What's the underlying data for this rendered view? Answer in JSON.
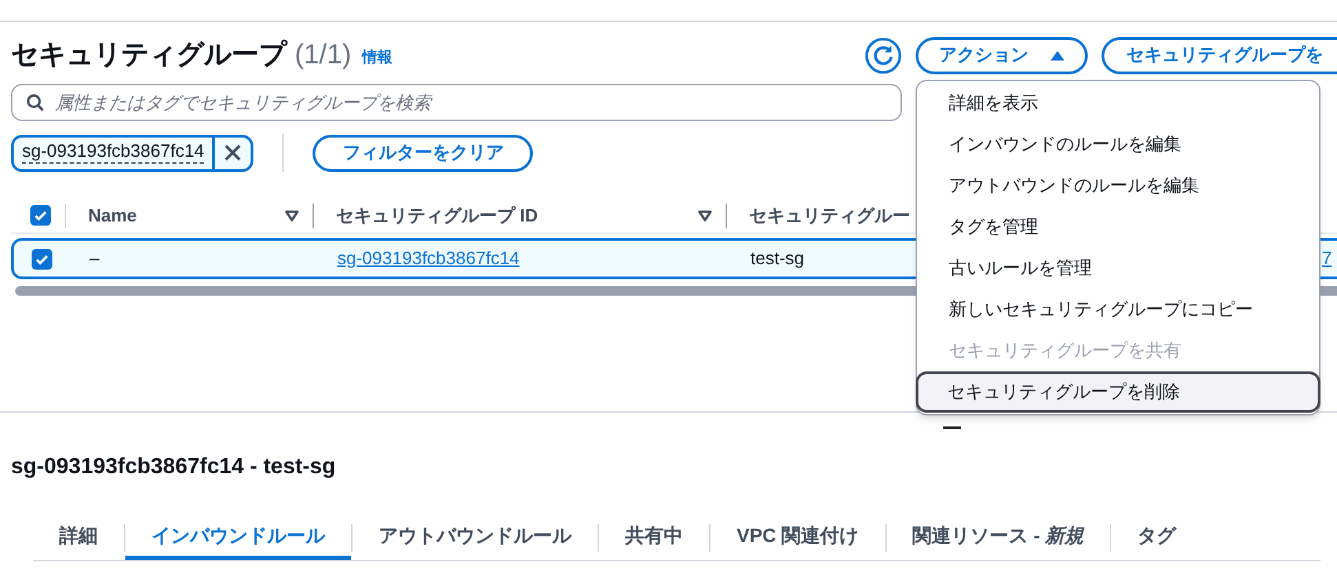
{
  "header": {
    "title": "セキュリティグループ",
    "count": "(1/1)",
    "info_link": "情報"
  },
  "toolbar": {
    "actions_button": "アクション",
    "actions_expanded": true,
    "create_button": "セキュリティグループを"
  },
  "search": {
    "placeholder": "属性またはタグでセキュリティグループを検索"
  },
  "filter": {
    "token": "sg-093193fcb3867fc14",
    "clear_button": "フィルターをクリア"
  },
  "table": {
    "select_all_checked": true,
    "columns": [
      {
        "label": "Name",
        "sortable": true
      },
      {
        "label": "セキュリティグループ ID",
        "sortable": true
      },
      {
        "label": "セキュリティグルー"
      }
    ],
    "rows": [
      {
        "selected": true,
        "name": "–",
        "group_id": "sg-093193fcb3867fc14",
        "column_3": "test-sg",
        "column_4": "7"
      }
    ]
  },
  "actions_menu": {
    "items": [
      {
        "label": "詳細を表示",
        "disabled": false,
        "focused": false
      },
      {
        "label": "インバウンドのルールを編集",
        "disabled": false,
        "focused": false
      },
      {
        "label": "アウトバウンドのルールを編集",
        "disabled": false,
        "focused": false
      },
      {
        "label": "タグを管理",
        "disabled": false,
        "focused": false
      },
      {
        "label": "古いルールを管理",
        "disabled": false,
        "focused": false
      },
      {
        "label": "新しいセキュリティグループにコピー",
        "disabled": false,
        "focused": false
      },
      {
        "label": "セキュリティグループを共有",
        "disabled": true,
        "focused": false
      },
      {
        "label": "セキュリティグループを削除",
        "disabled": false,
        "focused": true
      }
    ]
  },
  "detail": {
    "title": "sg-093193fcb3867fc14 - test-sg",
    "tabs": [
      {
        "label": "詳細",
        "selected": false
      },
      {
        "label": "インバウンドルール",
        "selected": true
      },
      {
        "label": "アウトバウンドルール",
        "selected": false
      },
      {
        "label": "共有中",
        "selected": false
      },
      {
        "label": "VPC 関連付け",
        "selected": false
      },
      {
        "label": "関連リソース - *新規*",
        "selected": false
      },
      {
        "label": "タグ",
        "selected": false
      }
    ]
  }
}
